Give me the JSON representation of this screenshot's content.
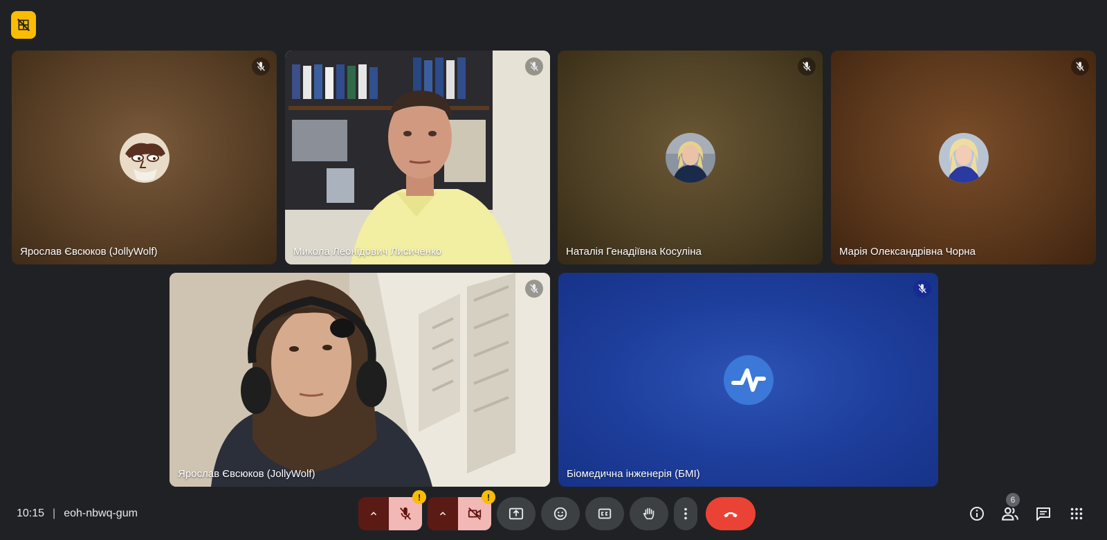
{
  "participants": [
    {
      "name": "Ярослав Євсюков (JollyWolf)",
      "muted": true
    },
    {
      "name": "Микола Леонідович Лисиченко",
      "muted": true
    },
    {
      "name": "Наталія Генадіївна Косуліна",
      "muted": true
    },
    {
      "name": "Марія Олександрівна Чорна",
      "muted": true
    },
    {
      "name": "Ярослав Євсюков (JollyWolf)",
      "muted": true
    },
    {
      "name": "Біомедична інженерія (БМІ)",
      "muted": true
    }
  ],
  "meeting": {
    "time": "10:15",
    "separator": "|",
    "code": "eoh-nbwq-gum"
  },
  "controls": {
    "mic_warning": "!",
    "camera_warning": "!"
  },
  "people_count": "6",
  "colors": {
    "end_call": "#ea4335",
    "warning": "#fbbc04",
    "muted_control": "#f2b8b5",
    "bmi_tile": "#1e3f9d"
  }
}
